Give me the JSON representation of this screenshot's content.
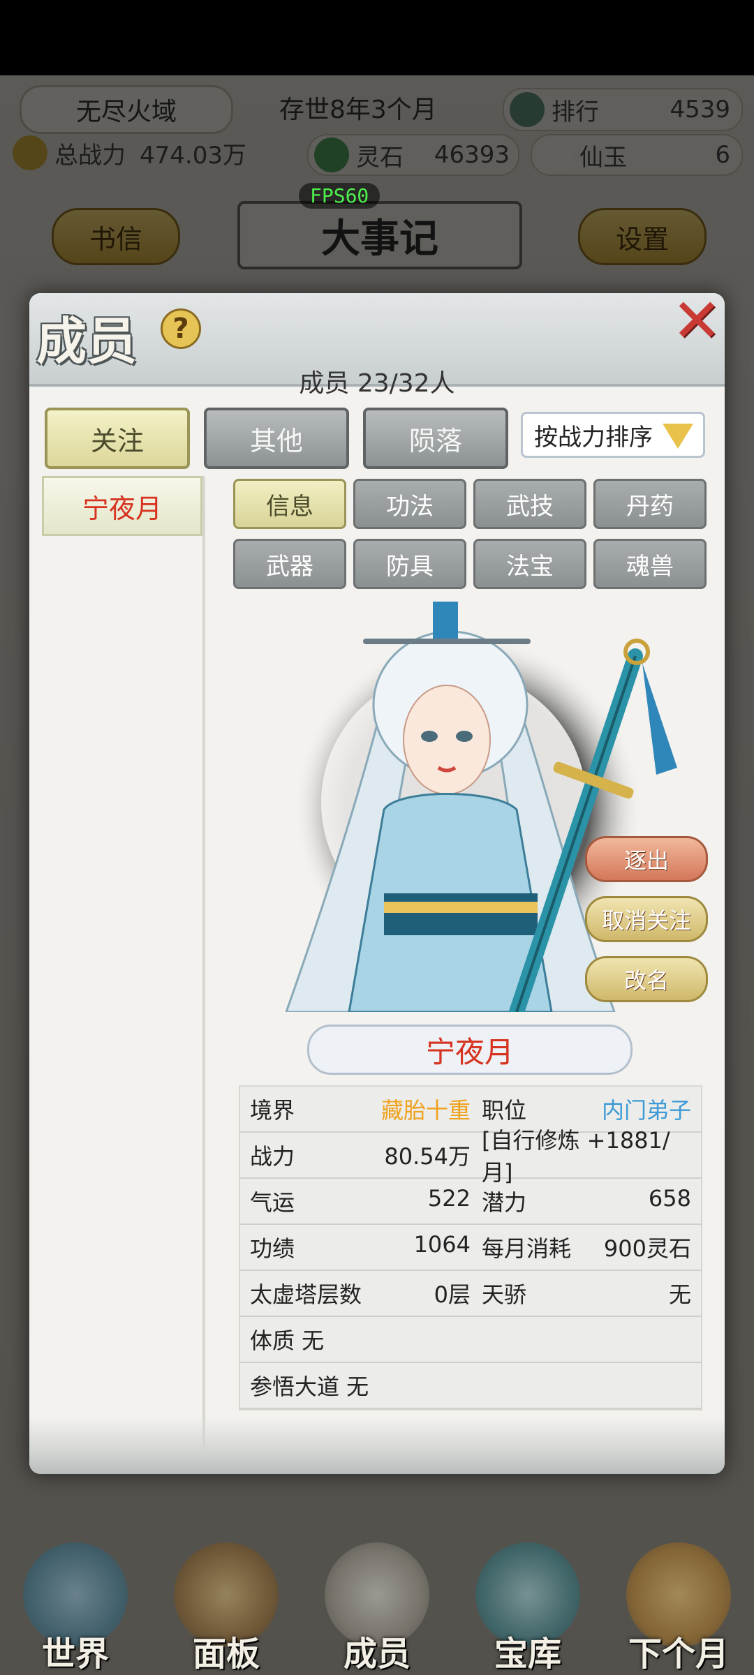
{
  "top": {
    "region": "无尽火域",
    "time": "存世8年3个月",
    "rank_label": "排行",
    "rank_value": "4539",
    "power_label": "总战力",
    "power_value": "474.03万",
    "spirit_stone_label": "灵石",
    "spirit_stone_value": "46393",
    "jade_label": "仙玉",
    "jade_value": "6",
    "letters_button": "书信",
    "chronicle_title": "大事记",
    "settings_button": "设置",
    "fps": "FPS60"
  },
  "dialog": {
    "title": "成员",
    "help": "?",
    "member_count": "成员  23/32人",
    "tabs": [
      "关注",
      "其他",
      "陨落"
    ],
    "sort_label": "按战力排序",
    "members": [
      "宁夜月"
    ],
    "sub_tabs": [
      "信息",
      "功法",
      "武技",
      "丹药",
      "武器",
      "防具",
      "法宝",
      "魂兽"
    ],
    "actions": {
      "expel": "逐出",
      "unfollow": "取消关注",
      "rename": "改名"
    },
    "character_name": "宁夜月",
    "info": {
      "realm_label": "境界",
      "realm_value": "藏胎十重",
      "position_label": "职位",
      "position_value": "内门弟子",
      "power_label": "战力",
      "power_value": "80.54万",
      "cultivation_note": "[自行修炼 +1881/月]",
      "luck_label": "气运",
      "luck_value": "522",
      "potential_label": "潜力",
      "potential_value": "658",
      "merit_label": "功绩",
      "merit_value": "1064",
      "monthly_cost_label": "每月消耗",
      "monthly_cost_value": "900灵石",
      "tower_label": "太虚塔层数",
      "tower_value": "0层",
      "prodigy_label": "天骄",
      "prodigy_value": "无",
      "physique": "体质 无",
      "dao": "参悟大道 无"
    }
  },
  "bottom_nav": [
    "世界",
    "面板",
    "成员",
    "宝库",
    "下个月"
  ]
}
